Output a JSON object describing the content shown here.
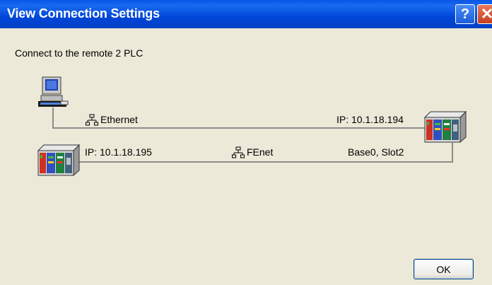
{
  "window": {
    "title": "View Connection Settings",
    "help_label": "?",
    "close_label": "✕"
  },
  "content": {
    "heading": "Connect to the remote 2 PLC",
    "link1": {
      "name": "Ethernet",
      "ip": "IP: 10.1.18.194"
    },
    "link2": {
      "ip": "IP: 10.1.18.195",
      "name": "FEnet",
      "location": "Base0, Slot2"
    }
  },
  "buttons": {
    "ok": "OK"
  }
}
